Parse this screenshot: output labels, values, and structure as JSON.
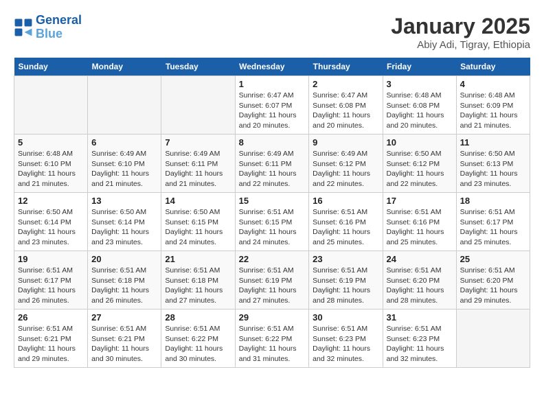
{
  "header": {
    "logo_line1": "General",
    "logo_line2": "Blue",
    "title": "January 2025",
    "subtitle": "Abiy Adi, Tigray, Ethiopia"
  },
  "weekdays": [
    "Sunday",
    "Monday",
    "Tuesday",
    "Wednesday",
    "Thursday",
    "Friday",
    "Saturday"
  ],
  "weeks": [
    [
      {
        "day": "",
        "detail": ""
      },
      {
        "day": "",
        "detail": ""
      },
      {
        "day": "",
        "detail": ""
      },
      {
        "day": "1",
        "detail": "Sunrise: 6:47 AM\nSunset: 6:07 PM\nDaylight: 11 hours\nand 20 minutes."
      },
      {
        "day": "2",
        "detail": "Sunrise: 6:47 AM\nSunset: 6:08 PM\nDaylight: 11 hours\nand 20 minutes."
      },
      {
        "day": "3",
        "detail": "Sunrise: 6:48 AM\nSunset: 6:08 PM\nDaylight: 11 hours\nand 20 minutes."
      },
      {
        "day": "4",
        "detail": "Sunrise: 6:48 AM\nSunset: 6:09 PM\nDaylight: 11 hours\nand 21 minutes."
      }
    ],
    [
      {
        "day": "5",
        "detail": "Sunrise: 6:48 AM\nSunset: 6:10 PM\nDaylight: 11 hours\nand 21 minutes."
      },
      {
        "day": "6",
        "detail": "Sunrise: 6:49 AM\nSunset: 6:10 PM\nDaylight: 11 hours\nand 21 minutes."
      },
      {
        "day": "7",
        "detail": "Sunrise: 6:49 AM\nSunset: 6:11 PM\nDaylight: 11 hours\nand 21 minutes."
      },
      {
        "day": "8",
        "detail": "Sunrise: 6:49 AM\nSunset: 6:11 PM\nDaylight: 11 hours\nand 22 minutes."
      },
      {
        "day": "9",
        "detail": "Sunrise: 6:49 AM\nSunset: 6:12 PM\nDaylight: 11 hours\nand 22 minutes."
      },
      {
        "day": "10",
        "detail": "Sunrise: 6:50 AM\nSunset: 6:12 PM\nDaylight: 11 hours\nand 22 minutes."
      },
      {
        "day": "11",
        "detail": "Sunrise: 6:50 AM\nSunset: 6:13 PM\nDaylight: 11 hours\nand 23 minutes."
      }
    ],
    [
      {
        "day": "12",
        "detail": "Sunrise: 6:50 AM\nSunset: 6:14 PM\nDaylight: 11 hours\nand 23 minutes."
      },
      {
        "day": "13",
        "detail": "Sunrise: 6:50 AM\nSunset: 6:14 PM\nDaylight: 11 hours\nand 23 minutes."
      },
      {
        "day": "14",
        "detail": "Sunrise: 6:50 AM\nSunset: 6:15 PM\nDaylight: 11 hours\nand 24 minutes."
      },
      {
        "day": "15",
        "detail": "Sunrise: 6:51 AM\nSunset: 6:15 PM\nDaylight: 11 hours\nand 24 minutes."
      },
      {
        "day": "16",
        "detail": "Sunrise: 6:51 AM\nSunset: 6:16 PM\nDaylight: 11 hours\nand 25 minutes."
      },
      {
        "day": "17",
        "detail": "Sunrise: 6:51 AM\nSunset: 6:16 PM\nDaylight: 11 hours\nand 25 minutes."
      },
      {
        "day": "18",
        "detail": "Sunrise: 6:51 AM\nSunset: 6:17 PM\nDaylight: 11 hours\nand 25 minutes."
      }
    ],
    [
      {
        "day": "19",
        "detail": "Sunrise: 6:51 AM\nSunset: 6:17 PM\nDaylight: 11 hours\nand 26 minutes."
      },
      {
        "day": "20",
        "detail": "Sunrise: 6:51 AM\nSunset: 6:18 PM\nDaylight: 11 hours\nand 26 minutes."
      },
      {
        "day": "21",
        "detail": "Sunrise: 6:51 AM\nSunset: 6:18 PM\nDaylight: 11 hours\nand 27 minutes."
      },
      {
        "day": "22",
        "detail": "Sunrise: 6:51 AM\nSunset: 6:19 PM\nDaylight: 11 hours\nand 27 minutes."
      },
      {
        "day": "23",
        "detail": "Sunrise: 6:51 AM\nSunset: 6:19 PM\nDaylight: 11 hours\nand 28 minutes."
      },
      {
        "day": "24",
        "detail": "Sunrise: 6:51 AM\nSunset: 6:20 PM\nDaylight: 11 hours\nand 28 minutes."
      },
      {
        "day": "25",
        "detail": "Sunrise: 6:51 AM\nSunset: 6:20 PM\nDaylight: 11 hours\nand 29 minutes."
      }
    ],
    [
      {
        "day": "26",
        "detail": "Sunrise: 6:51 AM\nSunset: 6:21 PM\nDaylight: 11 hours\nand 29 minutes."
      },
      {
        "day": "27",
        "detail": "Sunrise: 6:51 AM\nSunset: 6:21 PM\nDaylight: 11 hours\nand 30 minutes."
      },
      {
        "day": "28",
        "detail": "Sunrise: 6:51 AM\nSunset: 6:22 PM\nDaylight: 11 hours\nand 30 minutes."
      },
      {
        "day": "29",
        "detail": "Sunrise: 6:51 AM\nSunset: 6:22 PM\nDaylight: 11 hours\nand 31 minutes."
      },
      {
        "day": "30",
        "detail": "Sunrise: 6:51 AM\nSunset: 6:23 PM\nDaylight: 11 hours\nand 32 minutes."
      },
      {
        "day": "31",
        "detail": "Sunrise: 6:51 AM\nSunset: 6:23 PM\nDaylight: 11 hours\nand 32 minutes."
      },
      {
        "day": "",
        "detail": ""
      }
    ]
  ]
}
